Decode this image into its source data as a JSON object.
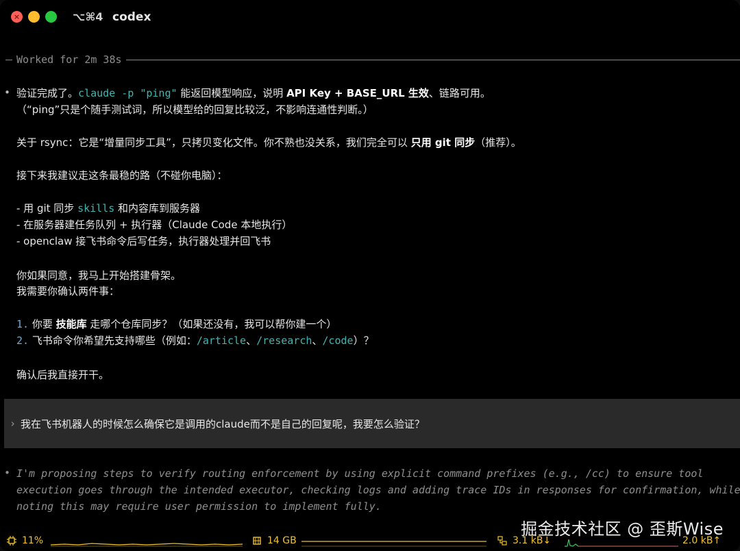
{
  "window": {
    "shortcut": "⌥⌘4",
    "title": "codex"
  },
  "worked_label": "Worked for 2m 38s",
  "assistant": {
    "l1_a": "验证完成了。",
    "l1_code": "claude -p \"ping\"",
    "l1_b": " 能返回模型响应，说明 ",
    "l1_bold": "API Key + BASE_URL 生效",
    "l1_c": "、链路可用。",
    "l2": "（“ping”只是个随手测试词，所以模型给的回复比较泛，不影响连通性判断。）",
    "l3_a": "关于 rsync：它是“增量同步工具”，只拷贝变化文件。你不熟也没关系，我们完全可以 ",
    "l3_bold": "只用 git 同步",
    "l3_b": "（推荐）。",
    "l4": "接下来我建议走这条最稳的路（不碰你电脑）：",
    "b1_a": "- 用 git 同步 ",
    "b1_code": "skills",
    "b1_b": " 和内容库到服务器",
    "b2": "- 在服务器建任务队列 + 执行器（Claude Code 本地执行）",
    "b3": "- openclaw 接飞书命令后写任务，执行器处理并回飞书",
    "l5": "你如果同意，我马上开始搭建骨架。",
    "l6": "我需要你确认两件事：",
    "q1_num": "1.",
    "q1_a": " 你要 ",
    "q1_bold": "技能库",
    "q1_b": " 走哪个仓库同步？（如果还没有，我可以帮你建一个）",
    "q2_num": "2.",
    "q2_a": " 飞书命令你希望先支持哪些（例如：",
    "q2_c1": "/article",
    "q2_s1": "、",
    "q2_c2": "/research",
    "q2_s2": "、",
    "q2_c3": "/code",
    "q2_b": "）？",
    "l7": "确认后我直接开干。"
  },
  "prompt": {
    "caret": "›",
    "text": "我在飞书机器人的时候怎么确保它是调用的claude而不是自己的回复呢，我要怎么验证？"
  },
  "thinking": {
    "l1": "I'm proposing steps to verify routing enforcement by using explicit command prefixes (e.g., /cc) to ensure tool",
    "l2": "execution goes through the intended executor, checking logs and adding trace IDs in responses for confirmation, while",
    "l3": "noting this may require user permission to implement fully."
  },
  "status": {
    "cpu": "11%",
    "mem": "14 GB",
    "net_down": "3.1 kB↓",
    "net_up": "2.0 kB↑",
    "accent": "#f2c12e",
    "cpu_icon": "cpu-chip-icon",
    "mem_icon": "memory-icon",
    "net_icon": "network-icon"
  },
  "watermark": "掘金技术社区 @ 歪斯Wise"
}
